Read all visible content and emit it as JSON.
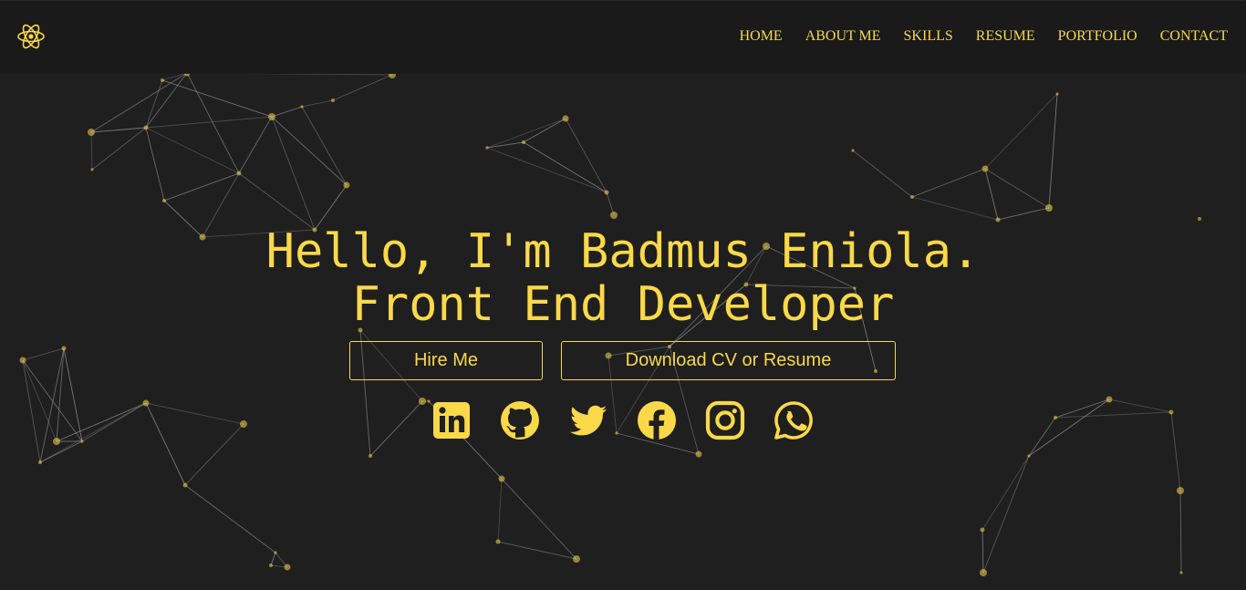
{
  "colors": {
    "accent": "#f9d84a",
    "background": "#1f1f1f",
    "navbar": "#1a1a1a",
    "line": "#9a9a9a"
  },
  "logo": {
    "icon": "react-atom-icon"
  },
  "nav": {
    "items": [
      {
        "label": "HOME"
      },
      {
        "label": "ABOUT ME"
      },
      {
        "label": "SKILLS"
      },
      {
        "label": "RESUME"
      },
      {
        "label": "PORTFOLIO"
      },
      {
        "label": "CONTACT"
      }
    ]
  },
  "hero": {
    "greeting": "Hello, I'm Badmus Eniola.",
    "role": "Front End Developer",
    "hire_label": "Hire Me",
    "download_label": "Download CV or Resume"
  },
  "social": [
    {
      "icon": "linkedin-icon"
    },
    {
      "icon": "github-icon"
    },
    {
      "icon": "twitter-icon"
    },
    {
      "icon": "facebook-icon"
    },
    {
      "icon": "instagram-icon"
    },
    {
      "icon": "whatsapp-icon"
    }
  ]
}
